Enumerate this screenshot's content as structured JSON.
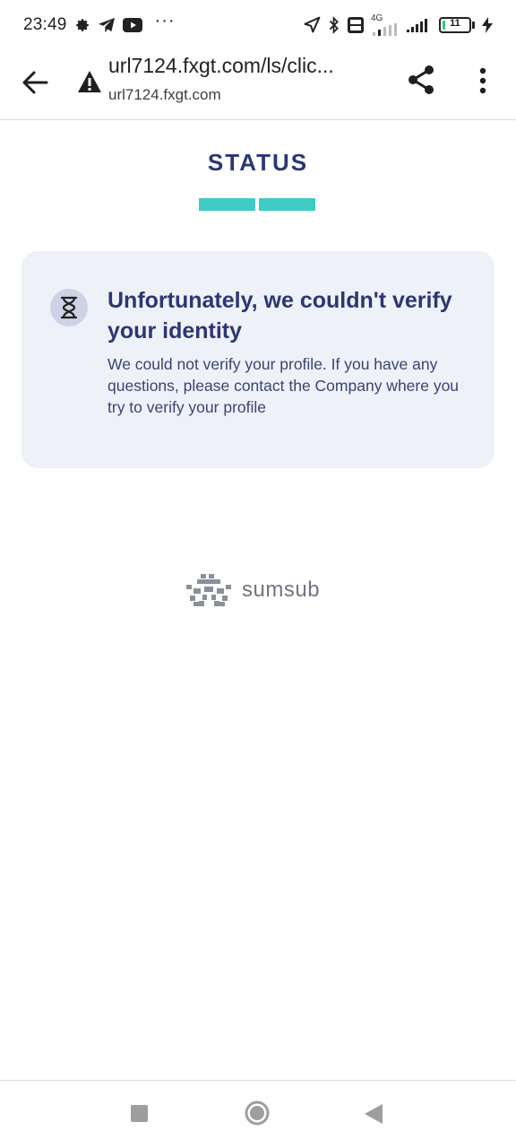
{
  "status_bar": {
    "time": "23:49",
    "more": "···",
    "network_label": "4G",
    "battery_level": "11",
    "battery_fraction": 0.11
  },
  "browser": {
    "url": "url7124.fxgt.com/ls/clic...",
    "domain": "url7124.fxgt.com"
  },
  "page": {
    "title": "STATUS",
    "steps_total": 2,
    "steps_completed": 2,
    "accent_color": "#3ecbc4",
    "heading_color": "#2b3674"
  },
  "card": {
    "title": "Unfortunately, we couldn't verify your identity",
    "message": "We could not verify your profile. If you have any questions, please contact the Company where you try to verify your profile"
  },
  "brand": {
    "name": "sumsub"
  },
  "icons": {
    "status": [
      "gear-icon",
      "telegram-icon",
      "youtube-icon",
      "location-icon",
      "bluetooth-icon",
      "volte-icon",
      "signal-icon",
      "battery-icon",
      "charging-icon"
    ],
    "toolbar": [
      "back-arrow-icon",
      "warning-icon",
      "share-icon",
      "menu-icon"
    ],
    "card": "hourglass-icon",
    "nav": [
      "recent-apps-icon",
      "home-icon",
      "back-icon"
    ]
  }
}
